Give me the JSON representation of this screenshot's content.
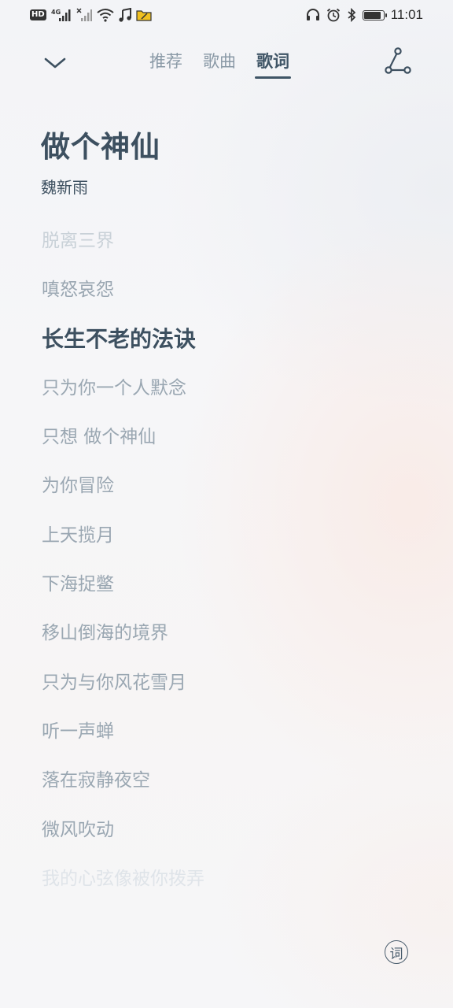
{
  "status_bar": {
    "left_labels": [
      "HD",
      "4G"
    ],
    "time": "11:01",
    "battery_level": 0.9,
    "icons": [
      "hd-icon",
      "signal-icon",
      "signal-no-sim-icon",
      "wifi-icon",
      "music-icon",
      "folder-icon",
      "headphones-icon",
      "alarm-icon",
      "bluetooth-icon",
      "battery-icon"
    ]
  },
  "nav": {
    "tabs": [
      {
        "label": "推荐",
        "active": false
      },
      {
        "label": "歌曲",
        "active": false
      },
      {
        "label": "歌词",
        "active": true
      }
    ],
    "icons": [
      "chevron-down-icon",
      "share-icon"
    ]
  },
  "song": {
    "title": "做个神仙",
    "artist": "魏新雨"
  },
  "lyrics": [
    "脱离三界",
    "嗔怒哀怨",
    "长生不老的法诀",
    "只为你一个人默念",
    "只想 做个神仙",
    "为你冒险",
    "上天揽月",
    "下海捉鳖",
    "移山倒海的境界",
    "只为与你风花雪月",
    "听一声蝉",
    "落在寂静夜空",
    "微风吹动",
    "我的心弦像被你拨弄"
  ],
  "current_lyric_index": 2,
  "lyric_toggle_label": "词",
  "colors": {
    "accent": "#3d5060",
    "inactive": "#9aa7b2"
  }
}
